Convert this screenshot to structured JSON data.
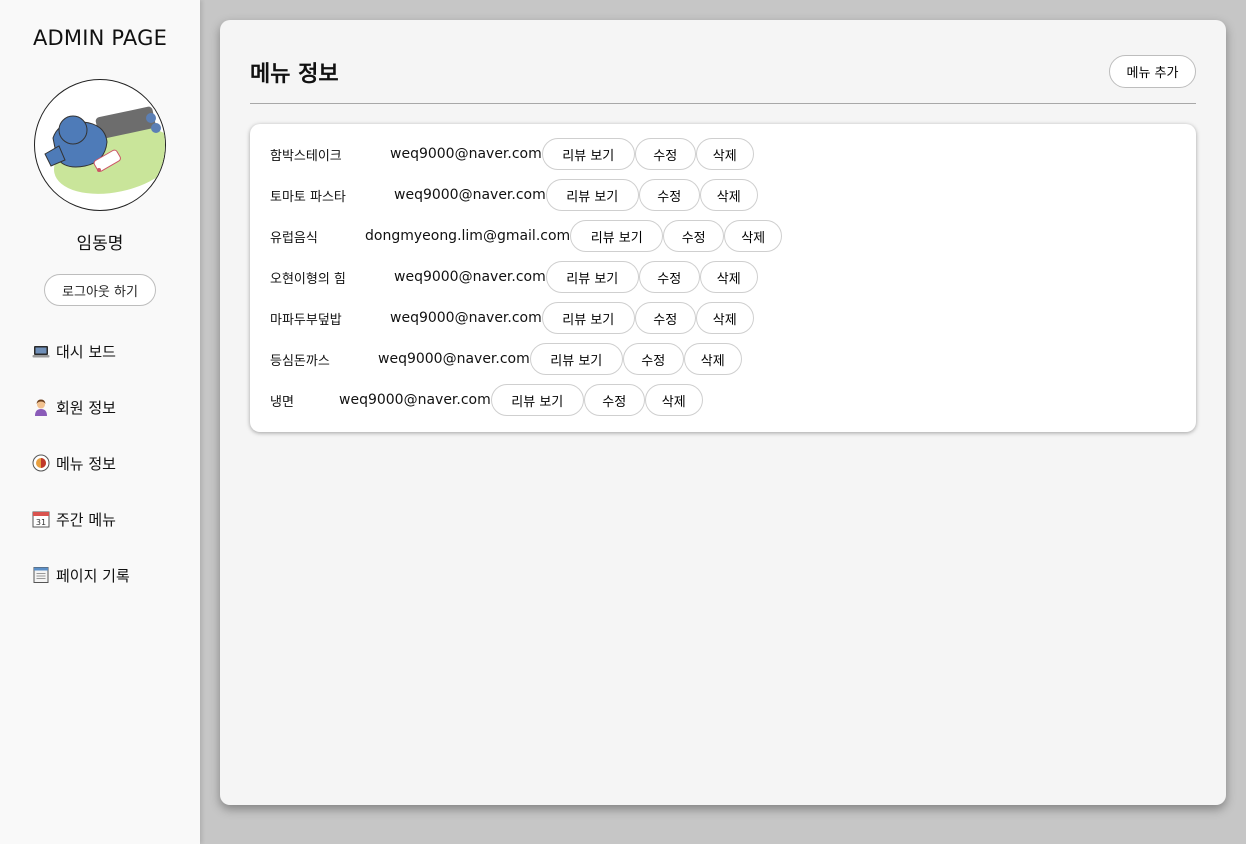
{
  "sidebar": {
    "brand": "ADMIN PAGE",
    "user_name": "임동명",
    "logout_label": "로그아웃 하기",
    "nav": [
      {
        "icon": "laptop-icon",
        "label": "대시 보드"
      },
      {
        "icon": "person-icon",
        "label": "회원 정보"
      },
      {
        "icon": "food-icon",
        "label": "메뉴 정보"
      },
      {
        "icon": "calendar-icon",
        "label": "주간 메뉴"
      },
      {
        "icon": "notebook-icon",
        "label": "페이지 기록"
      }
    ]
  },
  "main": {
    "title": "메뉴 정보",
    "add_label": "메뉴 추가",
    "actions": {
      "review": "리뷰 보기",
      "edit": "수정",
      "delete": "삭제"
    },
    "menus": [
      {
        "name": "함박스테이크",
        "email": "weq9000@naver.com"
      },
      {
        "name": "토마토 파스타",
        "email": "weq9000@naver.com"
      },
      {
        "name": "유럽음식",
        "email": "dongmyeong.lim@gmail.com"
      },
      {
        "name": "오현이형의 힘",
        "email": "weq9000@naver.com"
      },
      {
        "name": "마파두부덮밥",
        "email": "weq9000@naver.com"
      },
      {
        "name": "등심돈까스",
        "email": "weq9000@naver.com"
      },
      {
        "name": "냉면",
        "email": "weq9000@naver.com"
      }
    ]
  },
  "colors": {
    "background": "#c6c6c6",
    "sidebar": "#f9f9f9",
    "panel": "#f5f5f5",
    "card": "#ffffff"
  }
}
